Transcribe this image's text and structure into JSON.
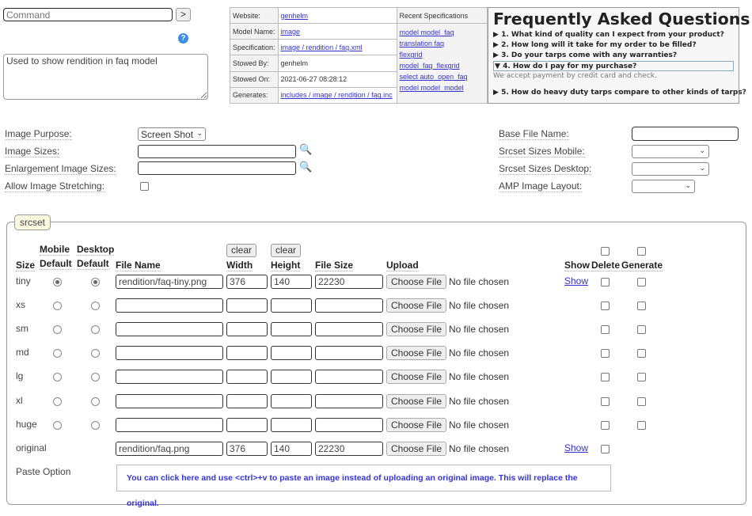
{
  "command": {
    "placeholder": "Command",
    "go_label": ">"
  },
  "description": "Used to show rendition in faq model",
  "info": {
    "rows": [
      {
        "label": "Website:",
        "value": "genhelm",
        "link": true
      },
      {
        "label": "Model Name:",
        "value": "image",
        "link": true
      },
      {
        "label": "Specification:",
        "value": "image / rendition / faq.xml",
        "link": true
      },
      {
        "label": "Stowed By:",
        "value": "genhelm",
        "link": false
      },
      {
        "label": "Stowed On:",
        "value": "2021-06-27 08:28:12",
        "link": false
      },
      {
        "label": "Generates:",
        "value": "includes / image / rendition / faq.inc",
        "link": true
      }
    ],
    "recent_title": "Recent Specifications",
    "recent": [
      "model model_faq",
      "translation faq",
      "flexgrid model_faq_flexgrid",
      "select auto_open_faq",
      "model model_model"
    ]
  },
  "faq": {
    "title": "Frequently Asked Questions",
    "questions": [
      "1. What kind of quality can I expect from your product?",
      "2. How long will it take for my order to be filled?",
      "3. Do your tarps come with any warranties?",
      "4. How do I pay for my purchase?",
      "5. How do heavy duty tarps compare to other kinds of tarps?"
    ],
    "open_index": 3,
    "answer": "We accept payment by credit card and check."
  },
  "form": {
    "image_purpose_label": "Image Purpose:",
    "image_purpose_value": "Screen Shot",
    "image_sizes_label": "Image Sizes:",
    "enlargement_label": "Enlargement Image Sizes:",
    "stretching_label": "Allow Image Stretching:",
    "base_file_label": "Base File Name:",
    "srcset_mobile_label": "Srcset Sizes Mobile:",
    "srcset_desktop_label": "Srcset Sizes Desktop:",
    "amp_label": "AMP Image Layout:"
  },
  "srcset": {
    "legend": "srcset",
    "headers": {
      "size": "Size",
      "mobile1": "Mobile",
      "mobile2": "Default",
      "desktop1": "Desktop",
      "desktop2": "Default",
      "file_name": "File Name",
      "width": "Width",
      "height": "Height",
      "file_size": "File Size",
      "upload": "Upload",
      "show": "Show",
      "delete": "Delete",
      "generate": "Generate",
      "clear": "clear"
    },
    "choose_file": "Choose File",
    "no_file": "No file chosen",
    "show_link": "Show",
    "rows": [
      {
        "size": "tiny",
        "file": "rendition/faq-tiny.png",
        "width": "376",
        "height": "140",
        "filesize": "22230",
        "mobile": true,
        "desktop": true,
        "show": true
      },
      {
        "size": "xs",
        "file": "",
        "width": "",
        "height": "",
        "filesize": "",
        "mobile": false,
        "desktop": false,
        "show": false
      },
      {
        "size": "sm",
        "file": "",
        "width": "",
        "height": "",
        "filesize": "",
        "mobile": false,
        "desktop": false,
        "show": false
      },
      {
        "size": "md",
        "file": "",
        "width": "",
        "height": "",
        "filesize": "",
        "mobile": false,
        "desktop": false,
        "show": false
      },
      {
        "size": "lg",
        "file": "",
        "width": "",
        "height": "",
        "filesize": "",
        "mobile": false,
        "desktop": false,
        "show": false
      },
      {
        "size": "xl",
        "file": "",
        "width": "",
        "height": "",
        "filesize": "",
        "mobile": false,
        "desktop": false,
        "show": false
      },
      {
        "size": "huge",
        "file": "",
        "width": "",
        "height": "",
        "filesize": "",
        "mobile": false,
        "desktop": false,
        "show": false
      },
      {
        "size": "original",
        "file": "rendition/faq.png",
        "width": "376",
        "height": "140",
        "filesize": "22230",
        "mobile": null,
        "desktop": null,
        "show": true
      }
    ],
    "paste_label": "Paste Option",
    "paste_text": "You can click here and use <ctrl>+v to paste an image instead of uploading an original image. This will replace the original."
  }
}
